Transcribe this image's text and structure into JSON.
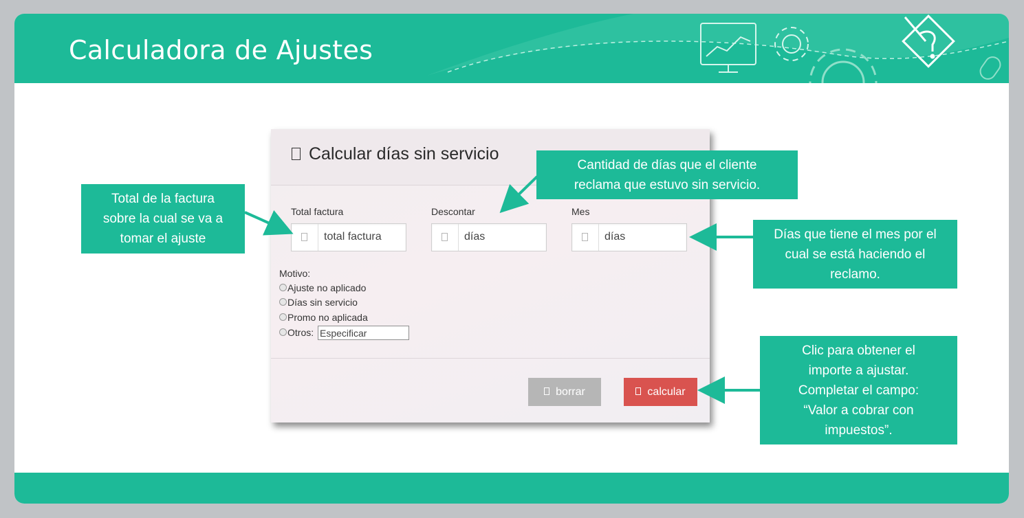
{
  "header": {
    "title": "Calculadora de Ajustes"
  },
  "form": {
    "title": "Calcular días sin servicio",
    "fields": [
      {
        "label": "Total factura",
        "placeholder": "total factura"
      },
      {
        "label": "Descontar",
        "placeholder": "días"
      },
      {
        "label": "Mes",
        "placeholder": "días"
      }
    ],
    "motivo_label": "Motivo:",
    "options": [
      "Ajuste no aplicado",
      "Días sin servicio",
      "Promo no aplicada",
      "Otros:"
    ],
    "otros_placeholder": "Especificar",
    "buttons": {
      "borrar": "borrar",
      "calcular": "calcular"
    }
  },
  "callouts": {
    "total": "Total de la factura\nsobre la cual se va a\ntomar el ajuste",
    "descontar": "Cantidad de días que el cliente\nreclama que estuvo sin servicio.",
    "mes": "Días que tiene el mes por el\ncual se está haciendo el\nreclamo.",
    "calcular": "Clic para obtener el\nimporte a ajustar.\nCompletar el campo:\n“Valor a cobrar con\nimpuestos”."
  },
  "colors": {
    "accent": "#1dba98",
    "calcular": "#d9534f",
    "borrar": "#b6b6b6"
  },
  "icons": [
    "monitor-chart-icon",
    "gear-icon",
    "pencil-document-icon",
    "mouse-icon"
  ]
}
